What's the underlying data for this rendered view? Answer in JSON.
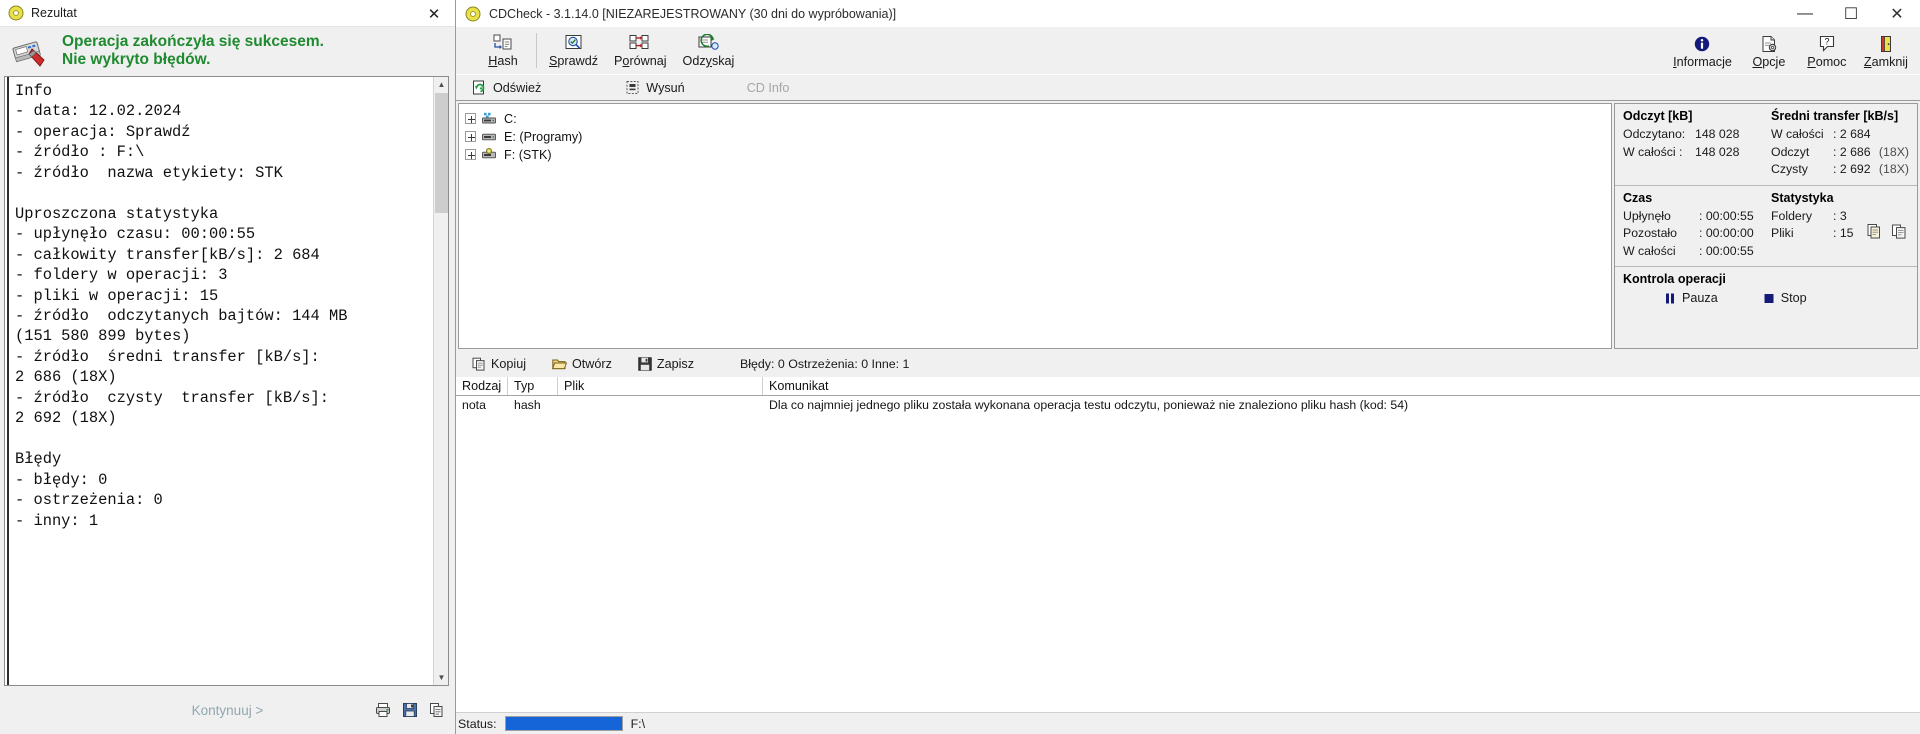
{
  "result_window": {
    "title": "Rezultat",
    "title_icon": "cd-disc-icon",
    "close_label": "✕",
    "header_icon": "cd-writer-icon",
    "headline_line1": "Operacja zakończyła się sukcesem.",
    "headline_line2": "Nie wykryto błędów.",
    "headline_color": "#1f8a30",
    "log_text": "Info\n- data: 12.02.2024\n- operacja: Sprawdź\n- źródło : F:\\\n- źródło  nazwa etykiety: STK\n\nUproszczona statystyka\n- upłynęło czasu: 00:00:55\n- całkowity transfer[kB/s]: 2 684\n- foldery w operacji: 3\n- pliki w operacji: 15\n- źródło  odczytanych bajtów: 144 MB\n(151 580 899 bytes)\n- źródło  średni transfer [kB/s]:\n2 686 (18X)\n- źródło  czysty  transfer [kB/s]:\n2 692 (18X)\n\nBłędy\n- błędy: 0\n- ostrzeżenia: 0\n- inny: 1",
    "continue_label": "Kontynuuj >",
    "footer_icons": [
      "print-icon",
      "save-icon",
      "copy-icon"
    ]
  },
  "cdcheck": {
    "title": "CDCheck - 3.1.14.0 [NIEZAREJESTROWANY (30 dni do wypróbowania)]",
    "title_icon": "cd-disc-icon",
    "window_buttons": {
      "minimize": "—",
      "maximize": "☐",
      "close": "✕"
    },
    "toolbar_left": [
      {
        "label": "Hash",
        "accel": "H",
        "icon": "hash-icon"
      },
      {
        "label": "Sprawdź",
        "accel": "S",
        "icon": "check-disc-icon"
      },
      {
        "label": "Porównaj",
        "accel": "o",
        "icon": "compare-icon"
      },
      {
        "label": "Odzyskaj",
        "accel": "y",
        "icon": "recover-icon"
      }
    ],
    "toolbar_right": [
      {
        "label": "Informacje",
        "accel": "I",
        "icon": "info-icon"
      },
      {
        "label": "Opcje",
        "accel": "O",
        "icon": "options-icon"
      },
      {
        "label": "Pomoc",
        "accel": "P",
        "icon": "help-icon"
      },
      {
        "label": "Zamknij",
        "accel": "Z",
        "icon": "exit-icon"
      }
    ],
    "subtoolbar": [
      {
        "label": "Odśwież",
        "icon": "refresh-icon",
        "disabled": false
      },
      {
        "label": "Wysuń",
        "icon": "eject-icon",
        "disabled": false
      },
      {
        "label": "CD Info",
        "icon": "cd-info-icon",
        "disabled": true
      }
    ],
    "drive_tree": [
      {
        "label": "C:",
        "icon": "network-drive-icon"
      },
      {
        "label": "E: (Programy)",
        "icon": "hard-drive-icon"
      },
      {
        "label": "F: (STK)",
        "icon": "cd-drive-icon"
      }
    ],
    "stats": {
      "read": {
        "heading": "Odczyt [kB]",
        "rows": [
          {
            "key": "Odczytano:",
            "value": "148 028"
          },
          {
            "key": "W całości  :",
            "value": "148 028"
          }
        ]
      },
      "avg_transfer": {
        "heading": "Średni transfer [kB/s]",
        "rows": [
          {
            "key": "W całości",
            "value": ": 2 684",
            "suffix": ""
          },
          {
            "key": "Odczyt",
            "value": ": 2 686",
            "suffix": "(18X)"
          },
          {
            "key": "Czysty",
            "value": ": 2 692",
            "suffix": "(18X)"
          }
        ]
      },
      "time": {
        "heading": "Czas",
        "rows": [
          {
            "key": "Upłynęło",
            "value": ": 00:00:55"
          },
          {
            "key": "Pozostało",
            "value": ": 00:00:00"
          },
          {
            "key": "W całości",
            "value": ": 00:00:55"
          }
        ]
      },
      "statistics": {
        "heading": "Statystyka",
        "rows": [
          {
            "key": "Foldery",
            "value": ": 3"
          },
          {
            "key": "Pliki",
            "value": ": 15"
          }
        ],
        "icons": [
          "copy-report-icon",
          "copy-clipboard-icon"
        ]
      },
      "control": {
        "heading": "Kontrola operacji",
        "buttons": [
          {
            "label": "Pauza",
            "icon": "pause-icon"
          },
          {
            "label": "Stop",
            "icon": "stop-icon"
          }
        ]
      }
    },
    "log_toolbar": {
      "buttons": [
        {
          "label": "Kopiuj",
          "icon": "copy-icon"
        },
        {
          "label": "Otwórz",
          "icon": "folder-open-icon"
        },
        {
          "label": "Zapisz",
          "icon": "save-icon"
        }
      ],
      "summary": "Błędy: 0 Ostrzeżenia: 0 Inne: 1"
    },
    "log_table": {
      "columns": [
        "Rodzaj",
        "Typ",
        "Plik",
        "Komunikat"
      ],
      "rows": [
        {
          "rodzaj": "nota",
          "typ": "hash",
          "plik": "",
          "komunikat": "Dla co najmniej jednego pliku została wykonana operacja testu odczytu, ponieważ nie znaleziono pliku hash (kod: 54)"
        }
      ]
    },
    "statusbar": {
      "label": "Status:",
      "progress_percent": 100,
      "progress_color": "#1565d8",
      "path": "F:\\"
    }
  }
}
